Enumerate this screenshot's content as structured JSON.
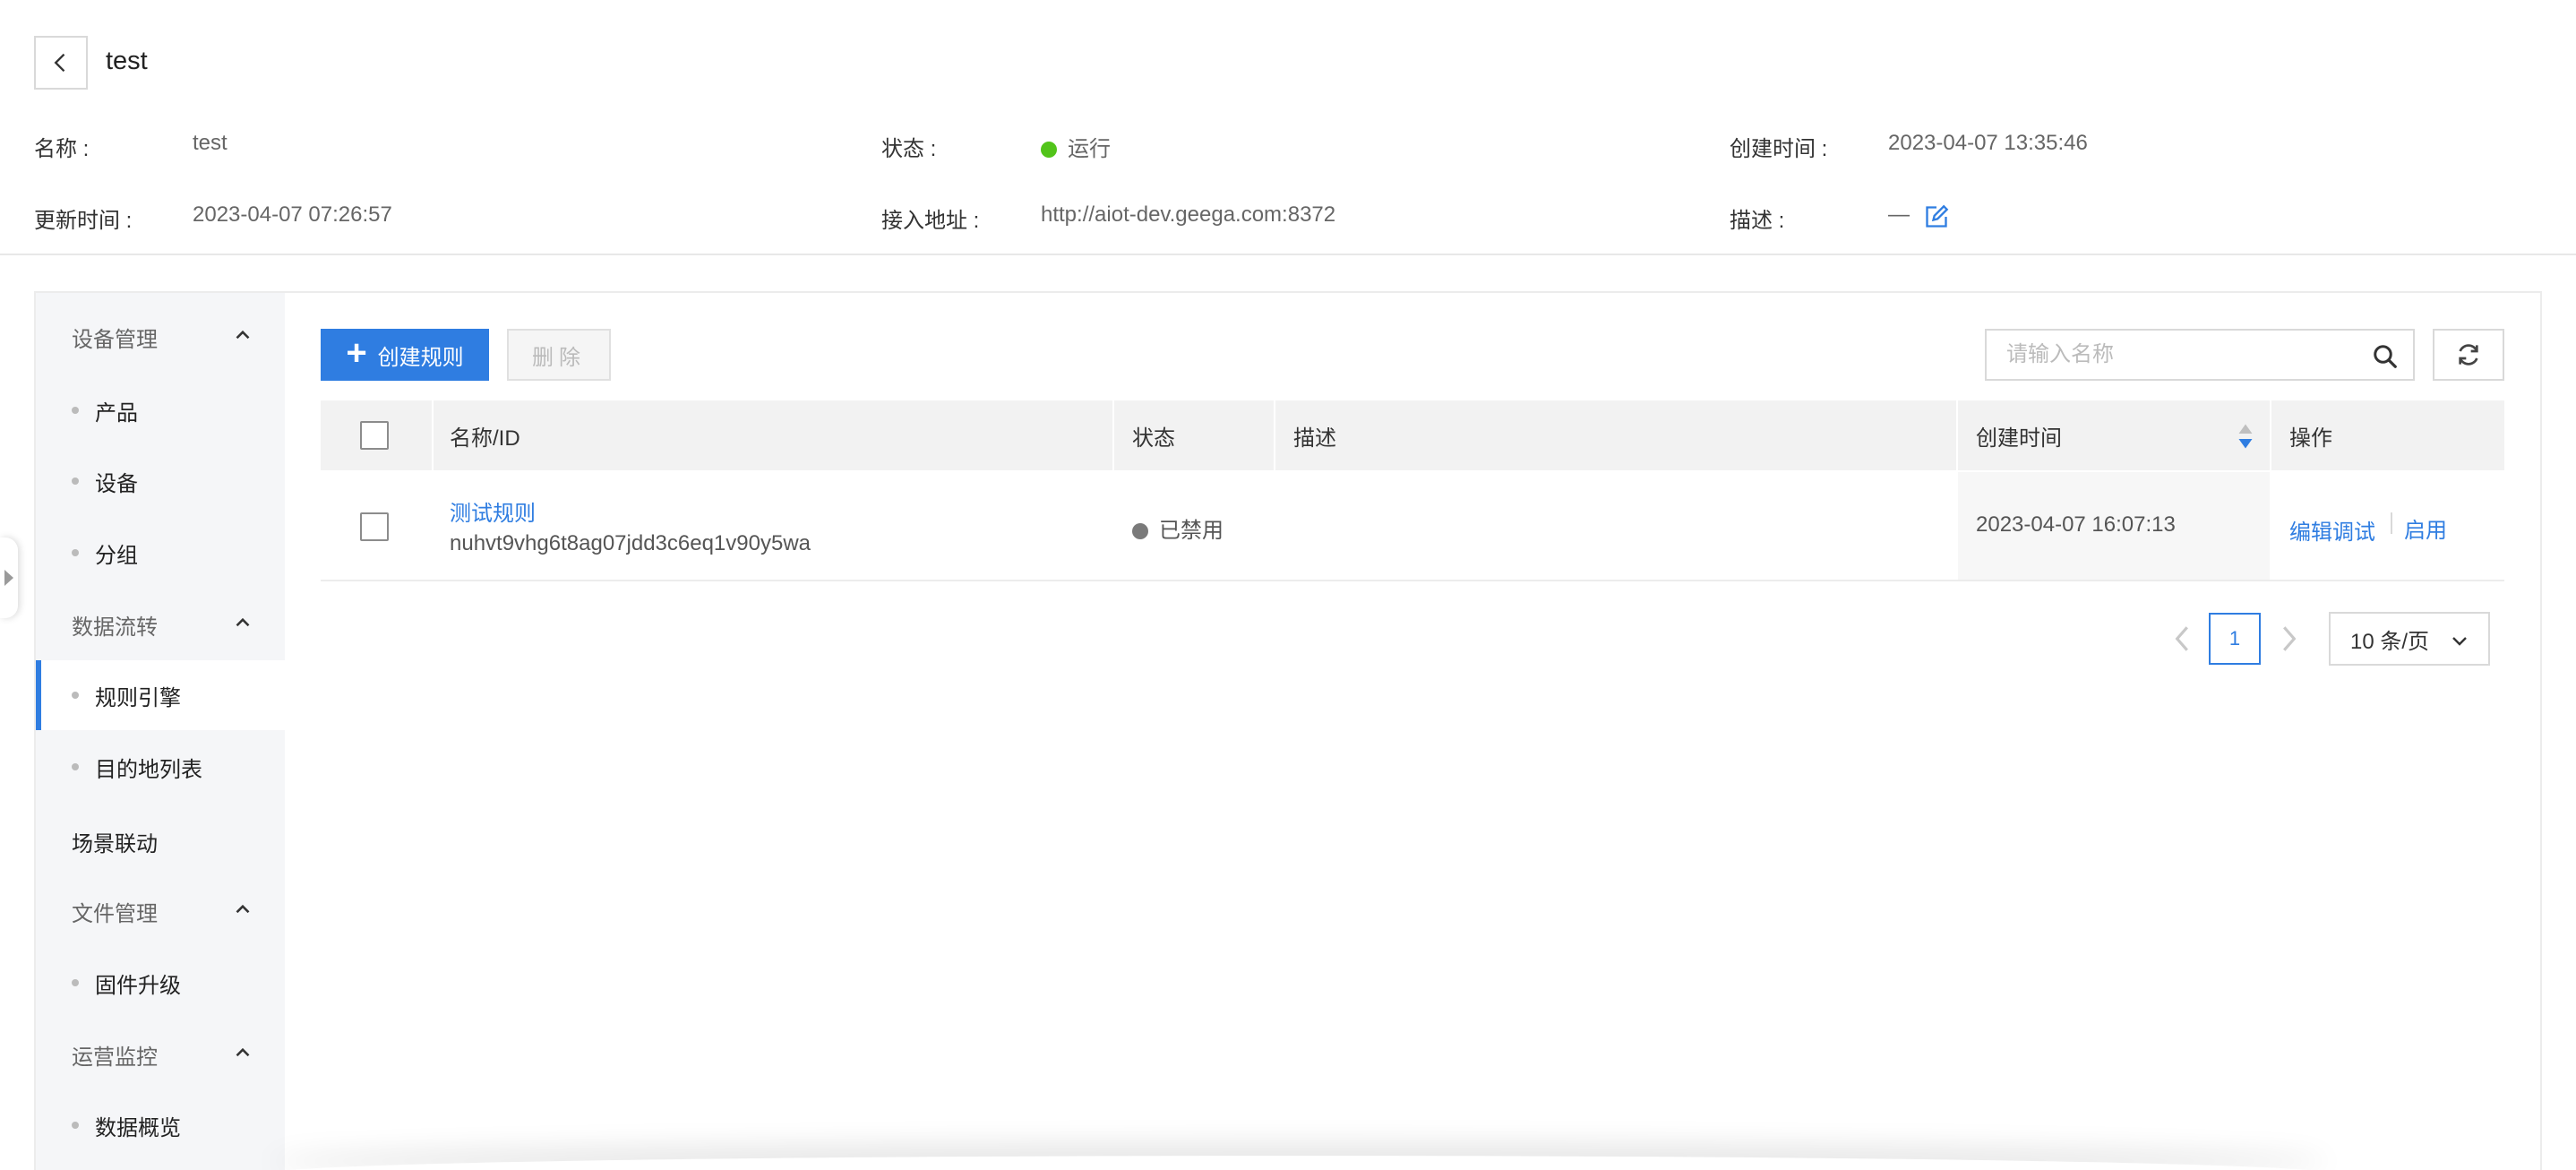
{
  "header": {
    "title": "test",
    "info": {
      "name_label": "名称 :",
      "name_value": "test",
      "status_label": "状态 :",
      "status_value": "运行",
      "created_label": "创建时间 :",
      "created_value": "2023-04-07 13:35:46",
      "updated_label": "更新时间 :",
      "updated_value": "2023-04-07 07:26:57",
      "endpoint_label": "接入地址 :",
      "endpoint_value": "http://aiot-dev.geega.com:8372",
      "desc_label": "描述 :",
      "desc_value": "—"
    }
  },
  "sidebar": {
    "groups": [
      {
        "label": "设备管理",
        "items": [
          "产品",
          "设备",
          "分组"
        ]
      },
      {
        "label": "数据流转",
        "items": [
          "规则引擎",
          "目的地列表"
        ]
      },
      {
        "label": "场景联动",
        "items": []
      },
      {
        "label": "文件管理",
        "items": [
          "固件升级"
        ]
      },
      {
        "label": "运营监控",
        "items": [
          "数据概览"
        ]
      }
    ],
    "active_item": "规则引擎"
  },
  "toolbar": {
    "create_label": "创建规则",
    "delete_label": "删除",
    "search_placeholder": "请输入名称"
  },
  "table": {
    "columns": [
      "名称/ID",
      "状态",
      "描述",
      "创建时间",
      "操作"
    ],
    "rows": [
      {
        "name": "测试规则",
        "id": "nuhvt9vhg6t8ag07jdd3c6eq1v90y5wa",
        "status": "已禁用",
        "description": "",
        "created": "2023-04-07 16:07:13",
        "actions": [
          "编辑调试",
          "启用"
        ]
      }
    ]
  },
  "pagination": {
    "current_page": "1",
    "page_size": "10 条/页"
  },
  "colors": {
    "primary": "#2f7de1",
    "status_running": "#52c41a",
    "status_disabled": "#7a7a7a"
  }
}
